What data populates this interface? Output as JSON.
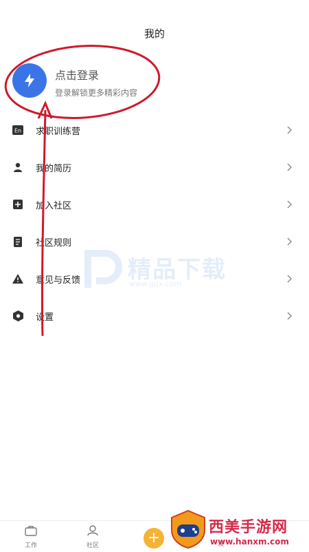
{
  "header": {
    "title": "我的"
  },
  "profile": {
    "title": "点击登录",
    "subtitle": "登录解锁更多精彩内容"
  },
  "menu": {
    "items": [
      {
        "label": "求职训练营",
        "icon": "en-badge-icon"
      },
      {
        "label": "我的简历",
        "icon": "person-icon"
      },
      {
        "label": "加入社区",
        "icon": "plus-square-icon"
      },
      {
        "label": "社区规则",
        "icon": "document-icon"
      },
      {
        "label": "意见与反馈",
        "icon": "warning-icon"
      },
      {
        "label": "设置",
        "icon": "hexagon-settings-icon"
      }
    ]
  },
  "watermark": {
    "text": "精品下载",
    "url": "www.jpjx.com"
  },
  "tabbar": {
    "tabs": [
      {
        "label": "工作"
      },
      {
        "label": "社区"
      },
      {
        "label": "发"
      }
    ]
  },
  "ad": {
    "text": "西美手游网",
    "url": "www.hanxm.com"
  },
  "colors": {
    "accent": "#3b74e6",
    "annotation": "#d0182b",
    "plus": "#f5b335"
  }
}
